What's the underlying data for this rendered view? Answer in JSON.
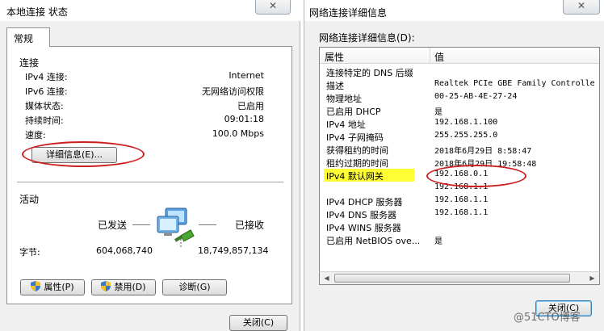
{
  "left_dialog": {
    "title": "本地连接 状态",
    "close_glyph": "✕",
    "tab_label": "常规",
    "connection": {
      "heading": "连接",
      "rows": [
        {
          "label": "IPv4 连接:",
          "value": "Internet"
        },
        {
          "label": "IPv6 连接:",
          "value": "无网络访问权限"
        },
        {
          "label": "媒体状态:",
          "value": "已启用"
        },
        {
          "label": "持续时间:",
          "value": "09:01:18"
        },
        {
          "label": "速度:",
          "value": "100.0 Mbps"
        }
      ],
      "details_button": "详细信息(E)..."
    },
    "activity": {
      "heading": "活动",
      "sent_label": "已发送",
      "received_label": "已接收",
      "bytes_label": "字节:",
      "bytes_sent": "604,068,740",
      "bytes_received": "18,749,857,134"
    },
    "buttons": {
      "properties": "属性(P)",
      "disable": "禁用(D)",
      "diagnose": "诊断(G)",
      "close": "关闭(C)"
    }
  },
  "right_dialog": {
    "title": "网络连接详细信息",
    "close_glyph": "✕",
    "list_label": "网络连接详细信息(D):",
    "columns": {
      "property": "属性",
      "value": "值"
    },
    "rows": [
      {
        "property": "连接特定的 DNS 后缀",
        "value": ""
      },
      {
        "property": "描述",
        "value": "Realtek PCIe GBE Family Controlle"
      },
      {
        "property": "物理地址",
        "value": "00-25-AB-4E-27-24"
      },
      {
        "property": "已启用 DHCP",
        "value": "是"
      },
      {
        "property": "IPv4 地址",
        "value": "192.168.1.100"
      },
      {
        "property": "IPv4 子网掩码",
        "value": "255.255.255.0"
      },
      {
        "property": "获得租约的时间",
        "value": "2018年6月29日 8:58:47"
      },
      {
        "property": "租约过期的时间",
        "value": "2018年6月29日 19:58:48"
      },
      {
        "property": "IPv4 默认网关",
        "value": "192.168.0.1"
      },
      {
        "property": "",
        "value": "192.168.1.1"
      },
      {
        "property": "IPv4 DHCP 服务器",
        "value": "192.168.1.1"
      },
      {
        "property": "IPv4 DNS 服务器",
        "value": "192.168.1.1"
      },
      {
        "property": "IPv4 WINS 服务器",
        "value": ""
      },
      {
        "property": "已启用 NetBIOS ove...",
        "value": "是"
      }
    ],
    "close_button": "关闭(C)"
  },
  "watermark": "@51CTO博客",
  "colors": {
    "annotation_red": "#cc1f1f",
    "highlight_yellow": "#ffff33"
  }
}
